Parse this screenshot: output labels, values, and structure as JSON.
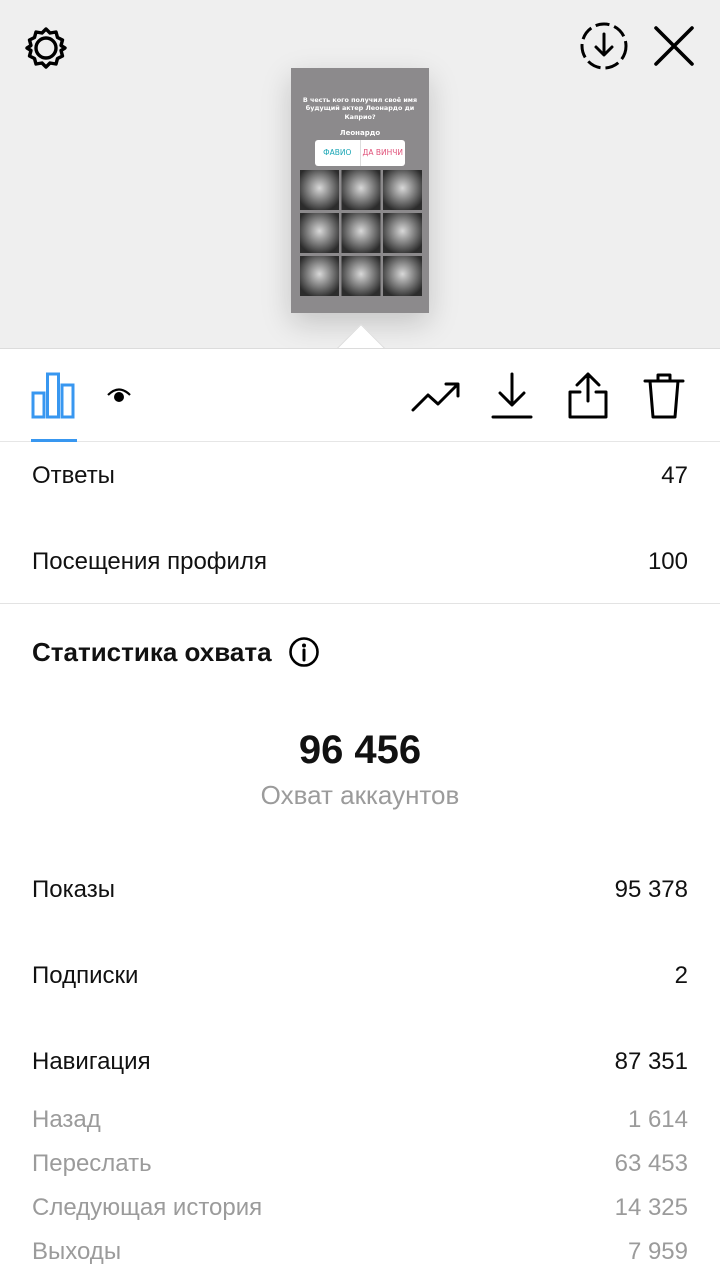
{
  "story_preview": {
    "question": "В честь кого получил своё имя будущий актер Леонардо ди Каприо?",
    "answer_name": "Леонардо",
    "poll_option_a": "ФАВИО",
    "poll_option_b": "ДА ВИНЧИ"
  },
  "toolbar": {
    "icons": [
      "bar-chart-icon",
      "eye-icon",
      "trending-up-icon",
      "download-icon",
      "share-icon",
      "trash-icon"
    ],
    "accent_color": "#3897f0"
  },
  "interactions": [
    {
      "label": "Ответы",
      "value": "47"
    },
    {
      "label": "Посещения профиля",
      "value": "100"
    }
  ],
  "reach": {
    "title": "Статистика охвата",
    "accounts_reached": "96 456",
    "accounts_reached_label": "Охват аккаунтов",
    "rows": [
      {
        "label": "Показы",
        "value": "95 378"
      },
      {
        "label": "Подписки",
        "value": "2"
      },
      {
        "label": "Навигация",
        "value": "87 351"
      }
    ],
    "navigation_breakdown": [
      {
        "label": "Назад",
        "value": "1 614"
      },
      {
        "label": "Переслать",
        "value": "63 453"
      },
      {
        "label": "Следующая история",
        "value": "14 325"
      },
      {
        "label": "Выходы",
        "value": "7 959"
      }
    ]
  }
}
